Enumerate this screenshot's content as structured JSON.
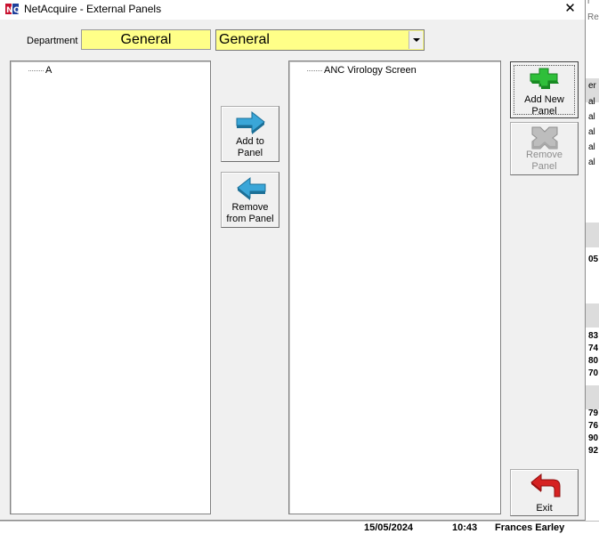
{
  "window": {
    "title": "NetAcquire - External Panels",
    "close_glyph": "✕"
  },
  "department": {
    "label": "Department",
    "value": "General",
    "select_value": "General",
    "highlight_color": "#ffff88"
  },
  "left_tree": {
    "items": [
      "A"
    ]
  },
  "right_tree": {
    "items": [
      "ANC Virology Screen"
    ]
  },
  "buttons": {
    "add_to_panel": "Add to\nPanel",
    "remove_from_panel": "Remove\nfrom Panel",
    "add_new_panel": "Add New\nPanel",
    "remove_panel": "Remove\nPanel",
    "exit": "Exit"
  },
  "icons": {
    "add_to_panel": "arrow-right-icon",
    "remove_from_panel": "arrow-left-icon",
    "add_new_panel": "plus-icon",
    "remove_panel": "remove-icon",
    "exit": "exit-arrow-icon"
  },
  "background_app": {
    "header_fragments": [
      "r",
      "Re"
    ],
    "column_fragments": [
      "er",
      "al",
      "al",
      "al",
      "al",
      "al"
    ],
    "values_a": [
      "05"
    ],
    "values_b": [
      "83",
      "74",
      "80",
      "70"
    ],
    "values_c": [
      "79",
      "76",
      "90",
      "92"
    ],
    "bottom_row": {
      "date": "15/05/2024",
      "time": "10:43",
      "name": "Frances Earley"
    }
  }
}
